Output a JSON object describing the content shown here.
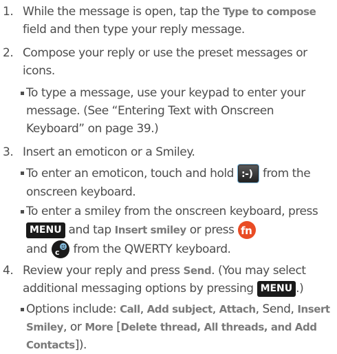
{
  "steps": [
    {
      "number": "1.",
      "before": "While the message is open, tap the ",
      "bold": "Type to compose",
      "after": " field and then type your reply message."
    },
    {
      "number": "2.",
      "text": "Compose your reply or use the preset messages or icons."
    },
    {
      "number": "3.",
      "text": "Insert an emoticon or a Smiley."
    },
    {
      "number": "4.",
      "before": "Review your reply and press ",
      "bold": "Send",
      "middle": ". (You may select additional messaging options by pressing ",
      "after": ".)"
    }
  ],
  "bullets": {
    "type_message": "To type a message, use your keypad to enter your message. (See “Entering Text with Onscreen Keyboard” on page 39.)",
    "emoticon_before": "To enter an emoticon, touch and hold ",
    "emoticon_after": " from the onscreen keyboard.",
    "smiley_a": "To enter a smiley from the onscreen keyboard, press ",
    "smiley_b": " and tap ",
    "smiley_bold": "Insert smiley",
    "smiley_c": " or press ",
    "smiley_d": "and ",
    "smiley_e": " from the QWERTY keyboard.",
    "options_a": "Options include: ",
    "opt_call": "Call",
    "sep1": ", ",
    "opt_add_subject": "Add subject",
    "sep2": ", ",
    "opt_attach": "Attach",
    "sep3": ", Send, ",
    "opt_insert_smiley": "Insert Smiley",
    "sep4": ", or ",
    "opt_more": "More",
    "sep5": " [",
    "opt_more_list": "Delete thread, All threads, and Add Contacts",
    "options_end": "])."
  },
  "keys": {
    "menu": "MENU",
    "emoticon_icon": "emoticon-key-icon",
    "fn_icon": "fn-key-icon",
    "smiley_key_icon": "smiley-key-icon"
  },
  "colors": {
    "text": "#4d4d4d",
    "bold_text": "#7a7a7a",
    "key_background": "#1a1a1a",
    "fn_key": "#e94c25",
    "emoticon_border": "#7fb6d8"
  }
}
